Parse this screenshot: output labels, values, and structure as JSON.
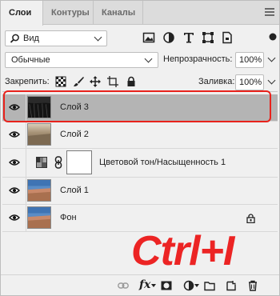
{
  "tabs": [
    {
      "label": "Слои",
      "active": true
    },
    {
      "label": "Контуры",
      "active": false
    },
    {
      "label": "Каналы",
      "active": false
    }
  ],
  "filter": {
    "label": "Вид"
  },
  "blend": {
    "mode": "Обычные",
    "opacity_label": "Непрозрачность:",
    "opacity_value": "100%"
  },
  "lock": {
    "label": "Закрепить:",
    "fill_label": "Заливка:",
    "fill_value": "100%"
  },
  "layers": [
    {
      "name": "Слой 3",
      "selected": true,
      "thumb": "dark-inverted"
    },
    {
      "name": "Слой 2",
      "selected": false,
      "thumb": "sepia"
    },
    {
      "name": "Цветовой тон/Насыщенность 1",
      "selected": false,
      "thumb": "adjustment"
    },
    {
      "name": "Слой 1",
      "selected": false,
      "thumb": "landscape"
    },
    {
      "name": "Фон",
      "selected": false,
      "thumb": "landscape",
      "locked": true
    }
  ],
  "overlay": {
    "shortcut": "Ctrl+I"
  },
  "colors": {
    "accent_red": "#e8221c",
    "selected_row": "#b4b4b4"
  }
}
